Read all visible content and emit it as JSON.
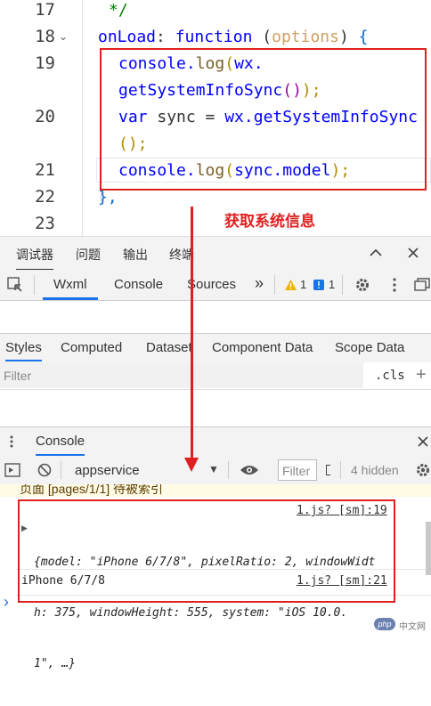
{
  "editor": {
    "line_numbers": [
      "17",
      "18",
      "19",
      "20",
      "21",
      "22",
      "23"
    ],
    "lines": {
      "l17": "*/",
      "l18_a": "onLoad",
      "l18_b": ": ",
      "l18_c": "function",
      "l18_d": " (",
      "l18_e": "options",
      "l18_f": ") ",
      "l18_g": "{",
      "l19_a": "console.",
      "l19_b": "log",
      "l19_c": "(",
      "l19_d": "wx.",
      "l19_e": "getSystemInfoSync",
      "l19_f": "()",
      "l19_g": ");",
      "l20_a": "var",
      "l20_b": " sync = ",
      "l20_c": "wx.getSystemInfoSync",
      "l20_d": "();",
      "l21_a": "console.",
      "l21_b": "log",
      "l21_c": "(",
      "l21_d": "sync.model",
      "l21_e": ");",
      "l22": "},"
    }
  },
  "annotation": {
    "text": "获取系统信息"
  },
  "devtools": {
    "top_tabs": [
      "调试器",
      "问题",
      "输出",
      "终端"
    ],
    "top_icons": [
      "chevron-up-icon",
      "close-icon"
    ],
    "toolbar": {
      "labels": [
        "Wxml",
        "Console",
        "Sources"
      ],
      "more": "»",
      "warn_count": "1",
      "info_count": "1"
    },
    "panel_tabs": [
      "Styles",
      "Computed",
      "Dataset",
      "Component Data",
      "Scope Data"
    ],
    "filter_placeholder": "Filter",
    "cls_label": ".cls",
    "plus": "+",
    "console_title": "Console",
    "console_toolbar": {
      "context": "appservice",
      "filter_placeholder": "Filter",
      "hidden": "4 hidden"
    },
    "warning_text": "页面 [pages/1/1] 待被索引",
    "logs": [
      {
        "source": "1.js? [sm]:19",
        "line1": "{model: \"iPhone 6/7/8\", pixelRatio: 2, windowWidt",
        "line2": "h: 375, windowHeight: 555, system: \"iOS 10.0.",
        "line3": "1\", …}"
      },
      {
        "source": "1.js? [sm]:21",
        "text": "iPhone 6/7/8"
      }
    ],
    "prompt": "›"
  },
  "watermark": {
    "text": "中文网",
    "logo": "php"
  },
  "colors": {
    "accent_red": "#e02020",
    "link_blue": "#1a73e8"
  }
}
